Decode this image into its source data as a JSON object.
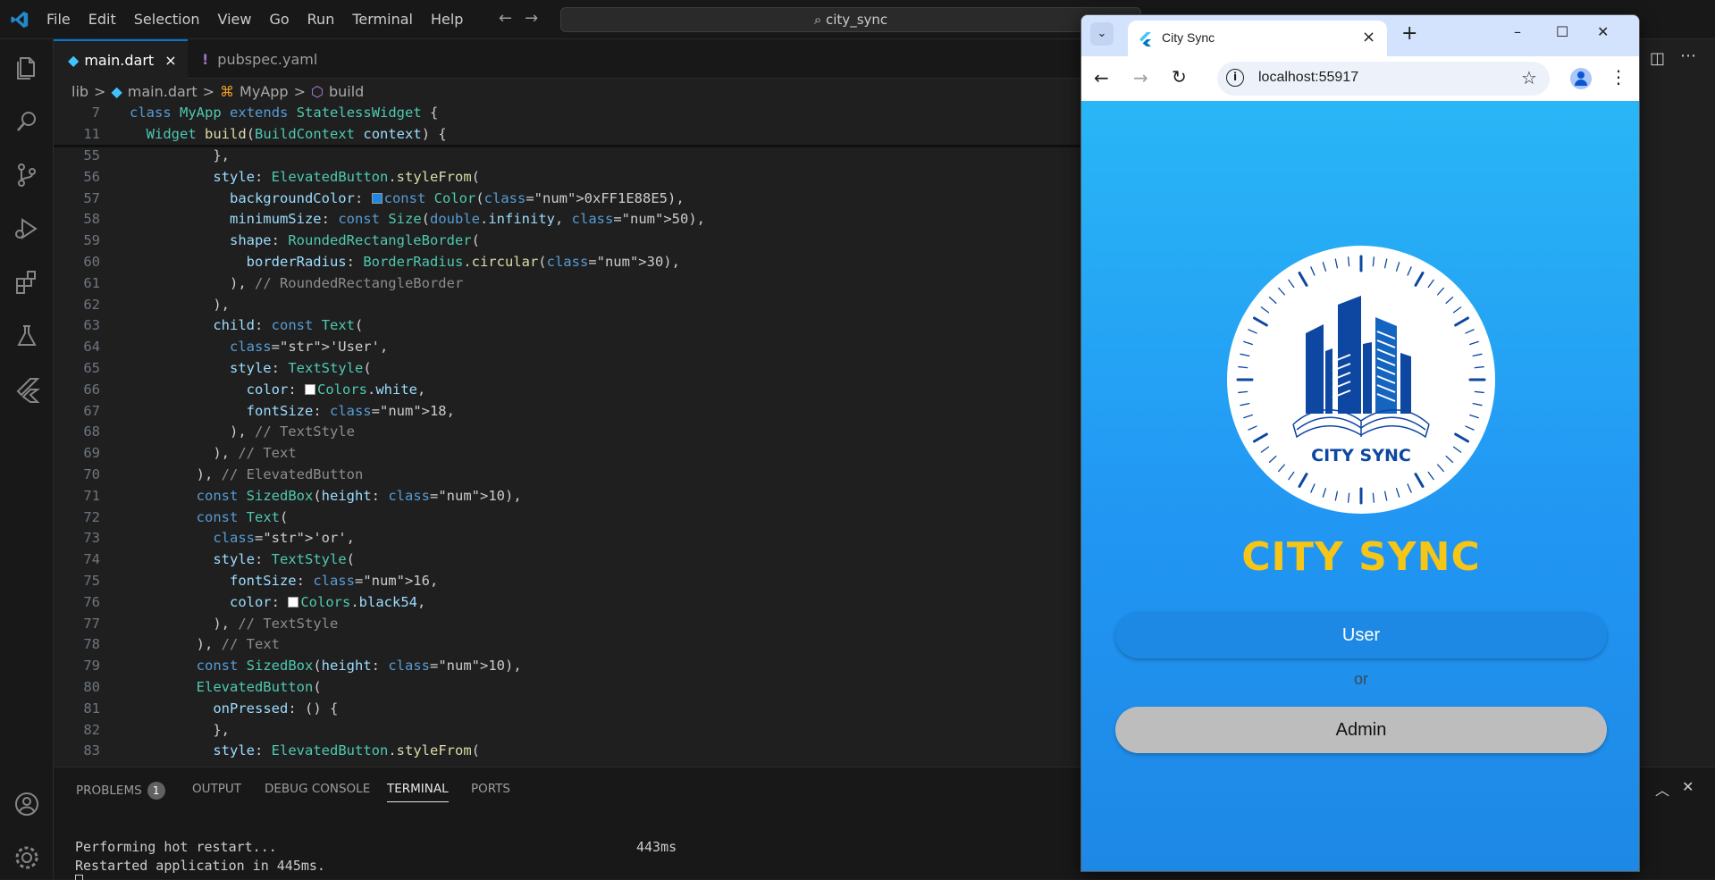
{
  "vscode": {
    "menu": [
      "File",
      "Edit",
      "Selection",
      "View",
      "Go",
      "Run",
      "Terminal",
      "Help"
    ],
    "command_center": "city_sync",
    "tabs": [
      {
        "label": "main.dart",
        "close": "×",
        "active": true
      },
      {
        "label": "pubspec.yaml",
        "close": "",
        "active": false
      }
    ],
    "breadcrumb": {
      "folder": "lib",
      "file": "main.dart",
      "class": "MyApp",
      "method": "build",
      "sep": ">"
    },
    "sticky_lines": [
      {
        "num": "7",
        "text": "class MyApp extends StatelessWidget {"
      },
      {
        "num": "11",
        "text": "  Widget build(BuildContext context) {"
      }
    ],
    "code_lines": [
      {
        "num": "55",
        "text": "          },"
      },
      {
        "num": "56",
        "text": "          style: ElevatedButton.styleFrom("
      },
      {
        "num": "57",
        "text": "            backgroundColor: ■const Color(0xFF1E88E5),"
      },
      {
        "num": "58",
        "text": "            minimumSize: const Size(double.infinity, 50),"
      },
      {
        "num": "59",
        "text": "            shape: RoundedRectangleBorder("
      },
      {
        "num": "60",
        "text": "              borderRadius: BorderRadius.circular(30),"
      },
      {
        "num": "61",
        "text": "            ), // RoundedRectangleBorder"
      },
      {
        "num": "62",
        "text": "          ),"
      },
      {
        "num": "63",
        "text": "          child: const Text("
      },
      {
        "num": "64",
        "text": "            'User',"
      },
      {
        "num": "65",
        "text": "            style: TextStyle("
      },
      {
        "num": "66",
        "text": "              color: □Colors.white,"
      },
      {
        "num": "67",
        "text": "              fontSize: 18,"
      },
      {
        "num": "68",
        "text": "            ), // TextStyle"
      },
      {
        "num": "69",
        "text": "          ), // Text"
      },
      {
        "num": "70",
        "text": "        ), // ElevatedButton"
      },
      {
        "num": "71",
        "text": "        const SizedBox(height: 10),"
      },
      {
        "num": "72",
        "text": "        const Text("
      },
      {
        "num": "73",
        "text": "          'or',"
      },
      {
        "num": "74",
        "text": "          style: TextStyle("
      },
      {
        "num": "75",
        "text": "            fontSize: 16,"
      },
      {
        "num": "76",
        "text": "            color: □Colors.black54,"
      },
      {
        "num": "77",
        "text": "          ), // TextStyle"
      },
      {
        "num": "78",
        "text": "        ), // Text"
      },
      {
        "num": "79",
        "text": "        const SizedBox(height: 10),"
      },
      {
        "num": "80",
        "text": "        ElevatedButton("
      },
      {
        "num": "81",
        "text": "          onPressed: () {"
      },
      {
        "num": "82",
        "text": "          },"
      },
      {
        "num": "83",
        "text": "          style: ElevatedButton.styleFrom("
      }
    ],
    "panel": {
      "tabs": [
        "PROBLEMS",
        "OUTPUT",
        "DEBUG CONSOLE",
        "TERMINAL",
        "PORTS"
      ],
      "problems_count": "1",
      "active_tab": "TERMINAL",
      "terminal_lines": [
        "Performing hot restart...",
        "Restarted application in 445ms."
      ],
      "timing": "443ms"
    }
  },
  "browser": {
    "tab_title": "City Sync",
    "tab_close": "×",
    "new_tab": "+",
    "url": "localhost:55917",
    "window_controls": {
      "minimize": "–",
      "maximize": "☐",
      "close": "✕"
    }
  },
  "app": {
    "logo_text": "CITY SYNC",
    "title": "CITY SYNC",
    "user_button": "User",
    "or_text": "or",
    "admin_button": "Admin"
  },
  "colors": {
    "accent": "#0078d4",
    "app_gradient_top": "#29b6f6",
    "app_gradient_bottom": "#1e88e5",
    "title_yellow": "#f5c518",
    "logo_blue": "#0d47a1",
    "user_button": "#1e88e5",
    "admin_button": "#bdbdbd"
  },
  "icons": [
    "vscode-logo-icon",
    "explorer-icon",
    "search-icon",
    "source-control-icon",
    "run-debug-icon",
    "extensions-icon",
    "testing-icon",
    "flutter-icon",
    "account-icon",
    "settings-gear-icon"
  ]
}
